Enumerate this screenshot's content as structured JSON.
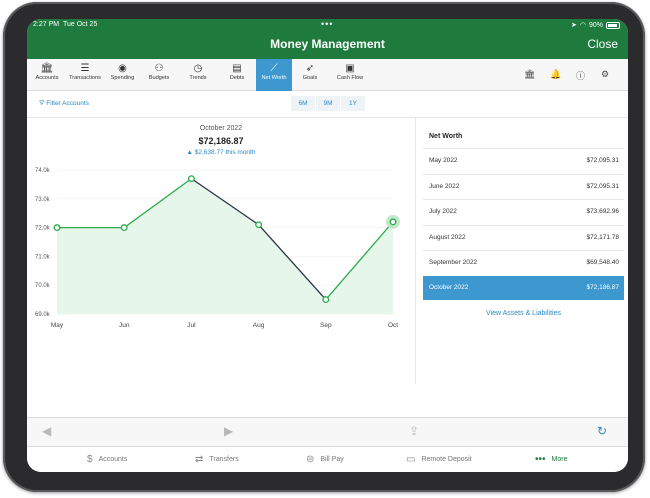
{
  "status_bar": {
    "time": "2:27 PM",
    "date": "Tue Oct 25",
    "battery": "90%"
  },
  "header": {
    "title": "Money Management",
    "close_label": "Close"
  },
  "nav": [
    {
      "label": "Accounts",
      "icon": "bank-icon"
    },
    {
      "label": "Transactions",
      "icon": "list-icon"
    },
    {
      "label": "Spending",
      "icon": "spending-icon"
    },
    {
      "label": "Budgets",
      "icon": "budget-icon"
    },
    {
      "label": "Trends",
      "icon": "clock-icon"
    },
    {
      "label": "Debts",
      "icon": "debt-icon"
    },
    {
      "label": "Net Worth",
      "icon": "trend-line-icon"
    },
    {
      "label": "Goals",
      "icon": "goal-icon"
    },
    {
      "label": "Cash Flow",
      "icon": "cashflow-icon"
    }
  ],
  "filter": {
    "label": "Filter Accounts",
    "ranges": [
      "6M",
      "9M",
      "1Y"
    ]
  },
  "summary": {
    "period": "October 2022",
    "amount": "$72,186.87",
    "change": "▲ $2,638.77 this month"
  },
  "chart_data": {
    "type": "line",
    "categories": [
      "May",
      "Jun",
      "Jul",
      "Aug",
      "Sep",
      "Oct"
    ],
    "values": [
      72.0,
      72.0,
      73.7,
      72.1,
      69.5,
      72.2
    ],
    "yticks": [
      "69.0k",
      "70.0k",
      "71.0k",
      "72.0k",
      "73.0k",
      "74.0k"
    ],
    "ylim": [
      69.0,
      74.0
    ],
    "fill_color": "#e6f6ea",
    "line_color": "#2cab4c",
    "decline_color": "#2a3447"
  },
  "net_worth": {
    "heading": "Net Worth",
    "rows": [
      {
        "month": "May 2022",
        "value": "$72,095.31"
      },
      {
        "month": "June 2022",
        "value": "$72,095.31"
      },
      {
        "month": "July 2022",
        "value": "$73,692.96"
      },
      {
        "month": "August 2022",
        "value": "$72,171.78"
      },
      {
        "month": "September 2022",
        "value": "$69,548.40"
      },
      {
        "month": "October 2022",
        "value": "$72,186.87"
      }
    ],
    "selected_index": 5,
    "assets_link": "View Assets & Liabilities"
  },
  "tabs": [
    {
      "label": "Accounts",
      "icon": "dollar-icon"
    },
    {
      "label": "Transfers",
      "icon": "transfer-icon"
    },
    {
      "label": "Bill Pay",
      "icon": "billpay-icon"
    },
    {
      "label": "Remote Deposit",
      "icon": "check-icon"
    },
    {
      "label": "More",
      "icon": "more-icon"
    }
  ],
  "colors": {
    "brand": "#1e7b3d",
    "accent": "#3d98cf"
  }
}
